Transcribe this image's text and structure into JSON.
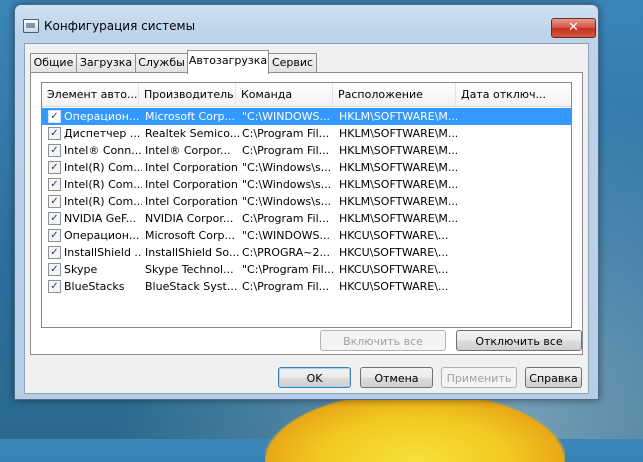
{
  "window": {
    "title": "Конфигурация системы",
    "close_glyph": "✕"
  },
  "tabs": [
    {
      "label": "Общие"
    },
    {
      "label": "Загрузка"
    },
    {
      "label": "Службы"
    },
    {
      "label": "Автозагрузка"
    },
    {
      "label": "Сервис"
    }
  ],
  "active_tab": "Автозагрузка",
  "columns": [
    "Элемент авто...",
    "Производитель",
    "Команда",
    "Расположение",
    "Дата отключ..."
  ],
  "rows": [
    {
      "checked": true,
      "item": "Операцион...",
      "vendor": "Microsoft Corp...",
      "command": "\"C:\\WINDOWS...",
      "location": "HKLM\\SOFTWARE\\M...",
      "date": ""
    },
    {
      "checked": true,
      "item": "Диспетчер ...",
      "vendor": "Realtek Semico...",
      "command": "C:\\Program Fil...",
      "location": "HKLM\\SOFTWARE\\M...",
      "date": ""
    },
    {
      "checked": true,
      "item": "Intel® Conn...",
      "vendor": "Intel® Corpor...",
      "command": "C:\\Program Fil...",
      "location": "HKLM\\SOFTWARE\\M...",
      "date": ""
    },
    {
      "checked": true,
      "item": "Intel(R) Com...",
      "vendor": "Intel Corporation",
      "command": "\"C:\\Windows\\s...",
      "location": "HKLM\\SOFTWARE\\M...",
      "date": ""
    },
    {
      "checked": true,
      "item": "Intel(R) Com...",
      "vendor": "Intel Corporation",
      "command": "\"C:\\Windows\\s...",
      "location": "HKLM\\SOFTWARE\\M...",
      "date": ""
    },
    {
      "checked": true,
      "item": "Intel(R) Com...",
      "vendor": "Intel Corporation",
      "command": "\"C:\\Windows\\s...",
      "location": "HKLM\\SOFTWARE\\M...",
      "date": ""
    },
    {
      "checked": true,
      "item": "NVIDIA GeF...",
      "vendor": "NVIDIA Corpor...",
      "command": "C:\\Program Fil...",
      "location": "HKLM\\SOFTWARE\\M...",
      "date": ""
    },
    {
      "checked": true,
      "item": "Операцион...",
      "vendor": "Microsoft Corp...",
      "command": "\"C:\\WINDOWS...",
      "location": "HKCU\\SOFTWARE\\...",
      "date": ""
    },
    {
      "checked": true,
      "item": "InstallShield ...",
      "vendor": "InstallShield So...",
      "command": "C:\\PROGRA~2...",
      "location": "HKCU\\SOFTWARE\\...",
      "date": ""
    },
    {
      "checked": true,
      "item": "Skype",
      "vendor": "Skype Technol...",
      "command": "\"C:\\Program Fil...",
      "location": "HKCU\\SOFTWARE\\...",
      "date": ""
    },
    {
      "checked": true,
      "item": "BlueStacks",
      "vendor": "BlueStack Syst...",
      "command": "C:\\Program Fil...",
      "location": "HKCU\\SOFTWARE\\...",
      "date": ""
    }
  ],
  "selected_row": 0,
  "panel_buttons": {
    "enable_all": "Включить все",
    "disable_all": "Отключить все"
  },
  "dialog_buttons": {
    "ok": "OK",
    "cancel": "Отмена",
    "apply": "Применить",
    "help": "Справка"
  },
  "check_glyph": "✓",
  "colors": {
    "selection": "#3399ff",
    "close_button": "#c2311d"
  }
}
